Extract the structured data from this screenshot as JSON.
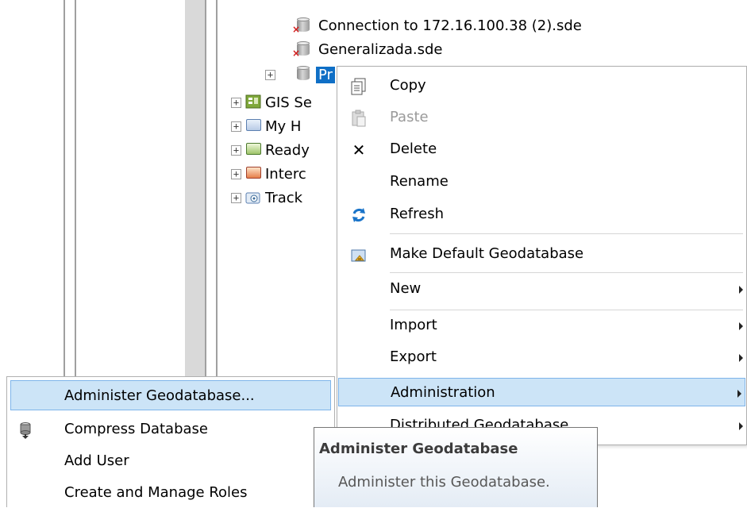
{
  "tree": {
    "items": [
      {
        "label": "Connection to 172.16.100.38 (2).sde",
        "icon": "database-error-icon"
      },
      {
        "label": "Generalizada.sde",
        "icon": "database-error-icon"
      },
      {
        "label": "Pr",
        "icon": "database-icon",
        "selected": true
      },
      {
        "label": "GIS Se",
        "icon": "gis-servers-icon"
      },
      {
        "label": "My H",
        "icon": "folder-icon"
      },
      {
        "label": "Ready",
        "icon": "folder-icon"
      },
      {
        "label": "Interc",
        "icon": "interop-connections-icon"
      },
      {
        "label": "Track",
        "icon": "tracking-connections-icon"
      }
    ]
  },
  "context_menu": {
    "items": [
      {
        "label": "Copy",
        "icon": "copy-icon"
      },
      {
        "label": "Paste",
        "icon": "paste-icon",
        "disabled": true
      },
      {
        "label": "Delete",
        "icon": "delete-icon"
      },
      {
        "label": "Rename"
      },
      {
        "label": "Refresh",
        "icon": "refresh-icon"
      },
      {
        "label": "Make Default Geodatabase",
        "icon": "default-geodatabase-icon"
      },
      {
        "label": "New",
        "submenu": true
      },
      {
        "label": "Import",
        "submenu": true
      },
      {
        "label": "Export",
        "submenu": true
      },
      {
        "label": "Administration",
        "submenu": true,
        "highlighted": true
      },
      {
        "label": "Distributed Geodatabase",
        "submenu": true
      }
    ]
  },
  "admin_submenu": {
    "items": [
      {
        "label": "Administer Geodatabase...",
        "highlighted": true
      },
      {
        "label": "Compress Database",
        "icon": "compress-icon"
      },
      {
        "label": "Add User"
      },
      {
        "label": "Create and Manage Roles"
      }
    ]
  },
  "tooltip": {
    "title": "Administer Geodatabase",
    "body": "Administer this Geodatabase."
  },
  "colors": {
    "highlight_bg": "#cce4f7",
    "highlight_border": "#7eb4ea",
    "selection": "#0f6fc6"
  }
}
